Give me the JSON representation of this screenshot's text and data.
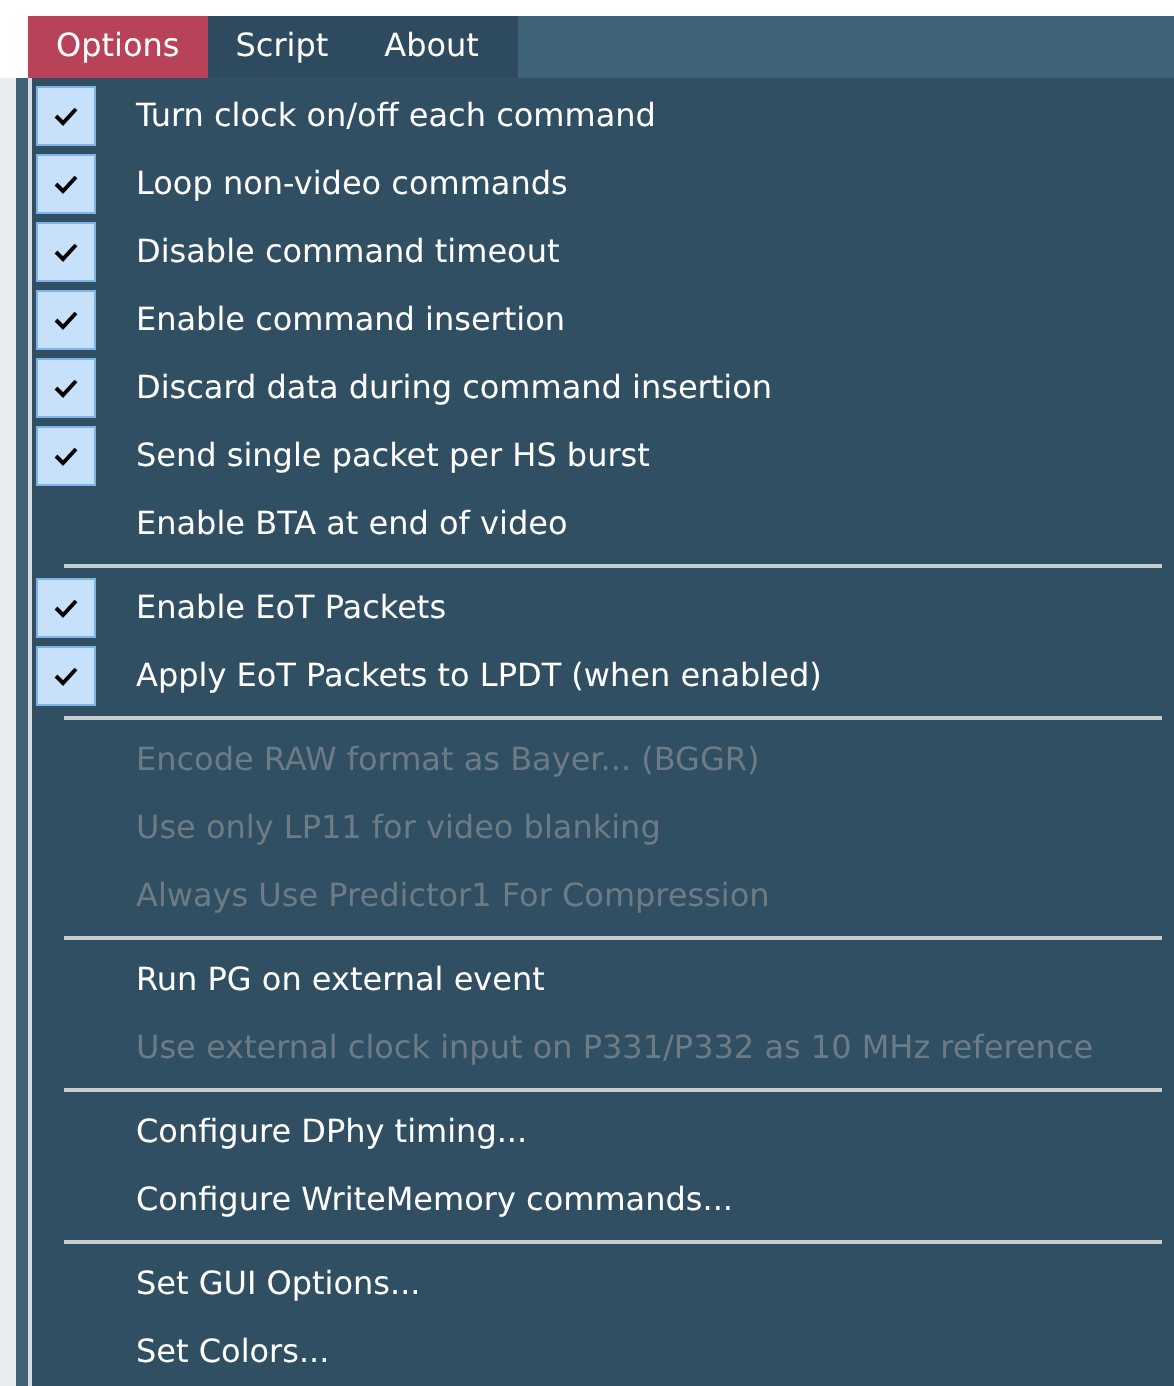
{
  "menubar": [
    {
      "label": "Options",
      "selected": true
    },
    {
      "label": "Script",
      "selected": false
    },
    {
      "label": "About",
      "selected": false
    }
  ],
  "menu": {
    "items": [
      {
        "kind": "item",
        "label": "Turn clock on/off each command",
        "checked": true,
        "disabled": false
      },
      {
        "kind": "item",
        "label": "Loop non-video commands",
        "checked": true,
        "disabled": false
      },
      {
        "kind": "item",
        "label": "Disable command timeout",
        "checked": true,
        "disabled": false
      },
      {
        "kind": "item",
        "label": "Enable command insertion",
        "checked": true,
        "disabled": false
      },
      {
        "kind": "item",
        "label": "Discard data during command insertion",
        "checked": true,
        "disabled": false
      },
      {
        "kind": "item",
        "label": "Send single packet per HS burst",
        "checked": true,
        "disabled": false
      },
      {
        "kind": "item",
        "label": "Enable BTA at end of video",
        "checked": false,
        "disabled": false
      },
      {
        "kind": "separator"
      },
      {
        "kind": "item",
        "label": "Enable EoT Packets",
        "checked": true,
        "disabled": false
      },
      {
        "kind": "item",
        "label": "Apply EoT Packets to LPDT (when enabled)",
        "checked": true,
        "disabled": false
      },
      {
        "kind": "separator"
      },
      {
        "kind": "item",
        "label": "Encode RAW format as Bayer... (BGGR)",
        "checked": false,
        "disabled": true
      },
      {
        "kind": "item",
        "label": "Use only LP11 for video blanking",
        "checked": false,
        "disabled": true
      },
      {
        "kind": "item",
        "label": "Always Use Predictor1 For Compression",
        "checked": false,
        "disabled": true
      },
      {
        "kind": "separator"
      },
      {
        "kind": "item",
        "label": "Run PG on external event",
        "checked": false,
        "disabled": false
      },
      {
        "kind": "item",
        "label": "Use external clock input on P331/P332 as 10 MHz reference",
        "checked": false,
        "disabled": true
      },
      {
        "kind": "separator"
      },
      {
        "kind": "item",
        "label": "Configure DPhy timing...",
        "checked": false,
        "disabled": false
      },
      {
        "kind": "item",
        "label": "Configure WriteMemory commands...",
        "checked": false,
        "disabled": false
      },
      {
        "kind": "separator"
      },
      {
        "kind": "item",
        "label": "Set GUI Options...",
        "checked": false,
        "disabled": false
      },
      {
        "kind": "item",
        "label": "Set Colors...",
        "checked": false,
        "disabled": false
      }
    ]
  }
}
